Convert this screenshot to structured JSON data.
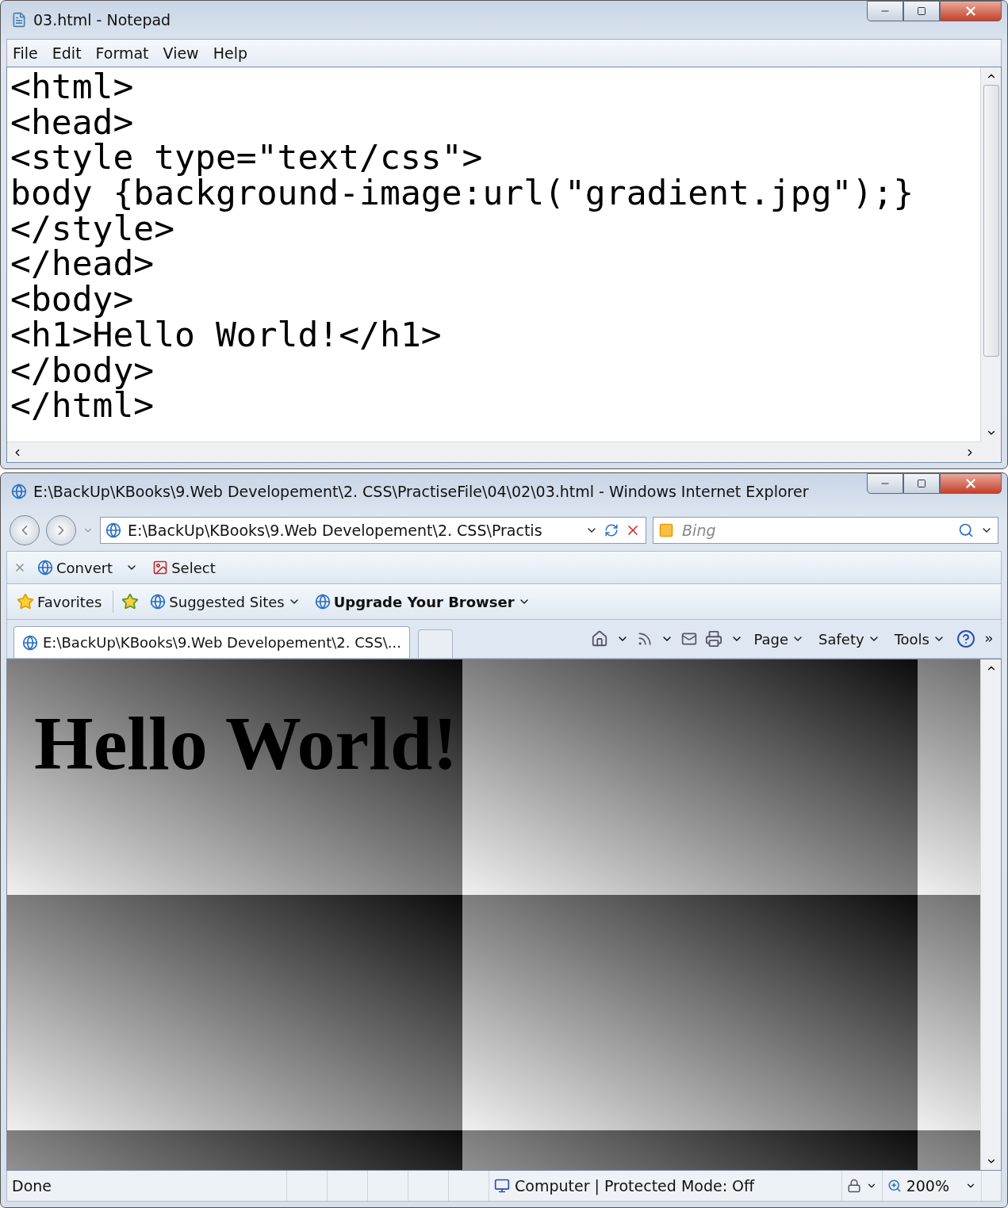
{
  "notepad": {
    "title": "03.html - Notepad",
    "menu": [
      "File",
      "Edit",
      "Format",
      "View",
      "Help"
    ],
    "code_lines": [
      "<html>",
      "<head>",
      "<style type=\"text/css\">",
      "body {background-image:url(\"gradient.jpg\");}",
      "</style>",
      "</head>",
      "<body>",
      "<h1>Hello World!</h1>",
      "</body>",
      "</html>"
    ]
  },
  "browser": {
    "title": "E:\\BackUp\\KBooks\\9.Web Developement\\2. CSS\\PractiseFile\\04\\02\\03.html - Windows Internet Explorer",
    "address": "E:\\BackUp\\KBooks\\9.Web Developement\\2. CSS\\Practis",
    "search": {
      "placeholder": "Bing"
    },
    "command_bar": [
      {
        "label": "Convert",
        "dropdown": true
      },
      {
        "label": "Select",
        "dropdown": false
      }
    ],
    "favorites": {
      "label": "Favorites",
      "links": [
        {
          "label": "Suggested Sites",
          "emphasized": false
        },
        {
          "label": "Upgrade Your Browser",
          "emphasized": true
        }
      ]
    },
    "tabs": [
      {
        "label": "E:\\BackUp\\KBooks\\9.Web Developement\\2. CSS\\...",
        "selected": true
      }
    ],
    "tools": [
      "Page",
      "Safety",
      "Tools"
    ],
    "page": {
      "heading": "Hello World!"
    },
    "status_bar": {
      "text": "Done",
      "zone": "Computer | Protected Mode: Off",
      "zoom": "200%"
    }
  }
}
